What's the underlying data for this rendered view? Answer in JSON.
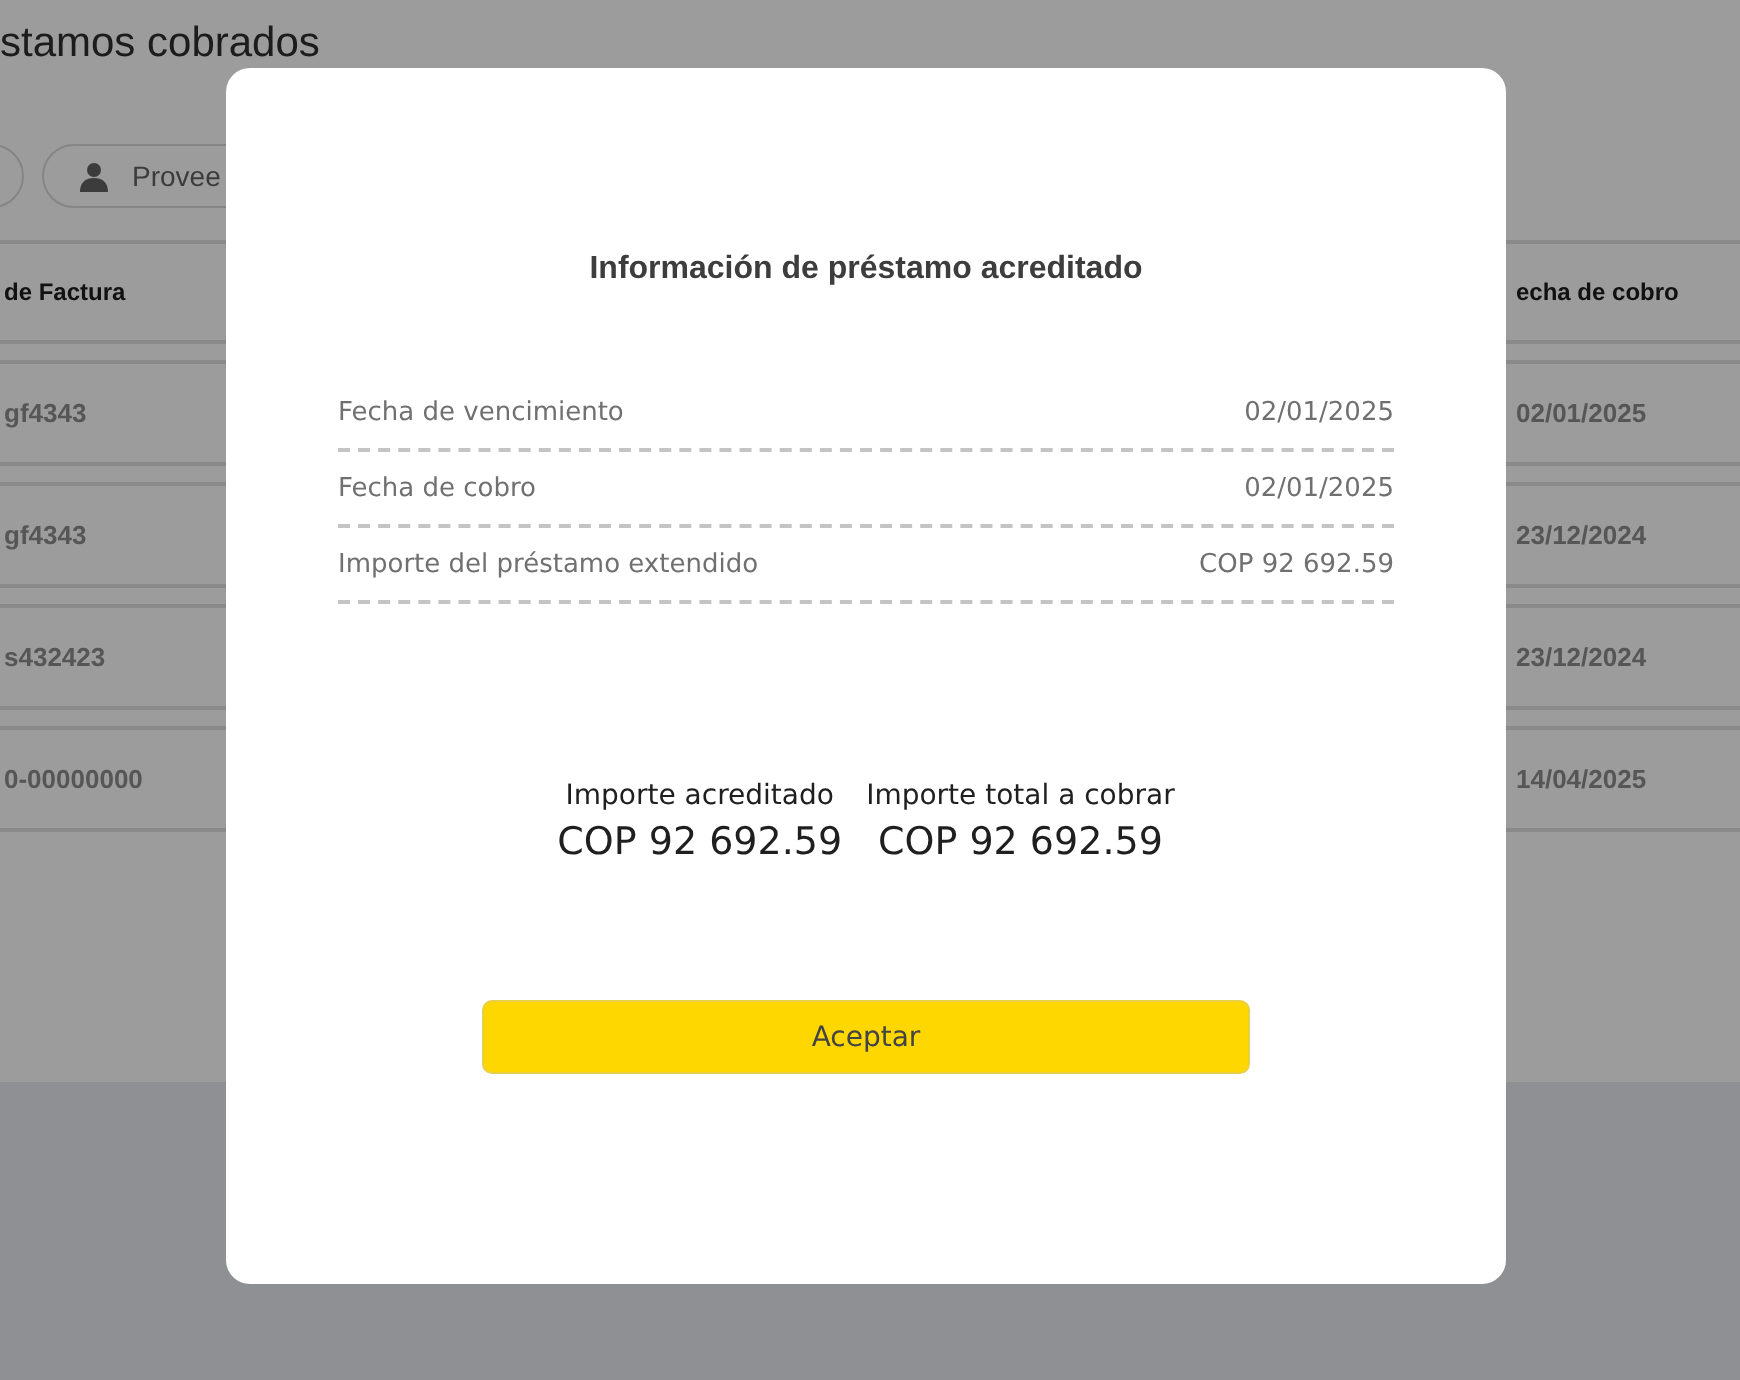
{
  "page": {
    "title": "stamos cobrados",
    "filters": [
      {
        "kind": "plain"
      },
      {
        "kind": "person",
        "label": "Provee"
      }
    ],
    "table": {
      "columns": [
        "de Factura",
        "echa de cobro"
      ],
      "rows": [
        {
          "cells": [
            "gf4343",
            "02/01/2025"
          ]
        },
        {
          "cells": [
            "gf4343",
            "23/12/2024"
          ]
        },
        {
          "cells": [
            "s432423",
            "23/12/2024"
          ]
        },
        {
          "cells": [
            "0-00000000",
            "14/04/2025"
          ]
        }
      ]
    }
  },
  "modal": {
    "title": "Información de préstamo acreditado",
    "details": [
      {
        "label": "Fecha de vencimiento",
        "value": "02/01/2025"
      },
      {
        "label": "Fecha de cobro",
        "value": "02/01/2025"
      },
      {
        "label": "Importe del préstamo extendido",
        "value": "COP 92 692.59"
      }
    ],
    "summary": [
      {
        "label": "Importe acreditado",
        "value": "COP 92 692.59"
      },
      {
        "label": "Importe total a cobrar",
        "value": "COP 92 692.59"
      }
    ],
    "button": "Aceptar"
  }
}
